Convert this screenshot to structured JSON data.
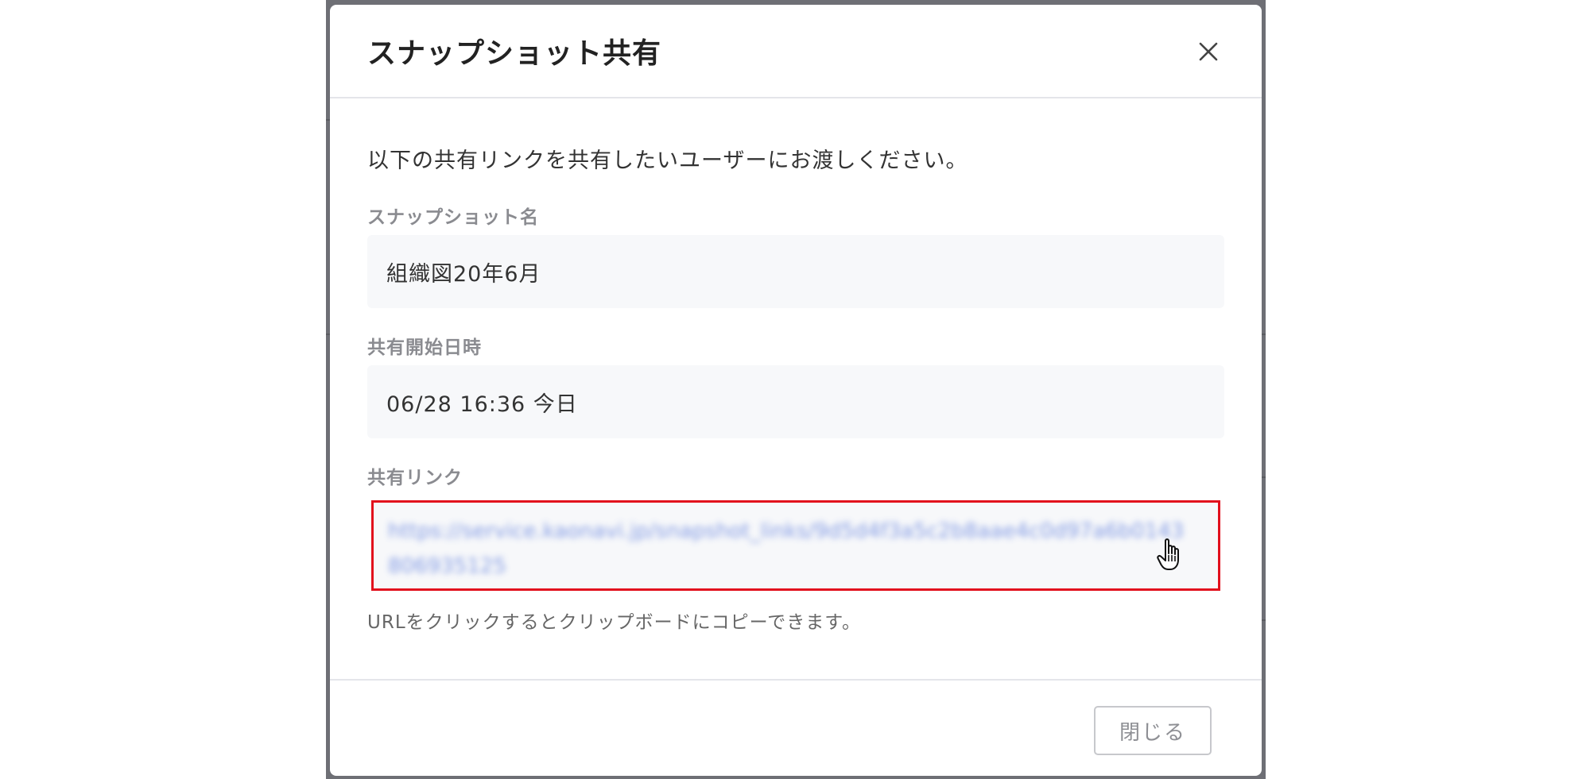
{
  "dialog": {
    "title": "スナップショット共有",
    "intro": "以下の共有リンクを共有したいユーザーにお渡しください。",
    "fields": {
      "snapshot_name": {
        "label": "スナップショット名",
        "value": "組織図20年6月"
      },
      "share_start": {
        "label": "共有開始日時",
        "value": "06/28 16:36 今日"
      },
      "share_link": {
        "label": "共有リンク",
        "value": "https://service.kaonavi.jp/snapshot_links/9d5d4f3a5c2b8aae4c0d97a6b0143806935125"
      }
    },
    "hint": "URLをクリックするとクリップボードにコピーできます。",
    "close_button_label": "閉じる"
  },
  "colors": {
    "highlight_border": "#e2101d",
    "backdrop": "#6e6f75",
    "field_background": "#f7f8fa"
  },
  "icons": {
    "close": "close-icon",
    "cursor": "hand-pointer-icon"
  }
}
